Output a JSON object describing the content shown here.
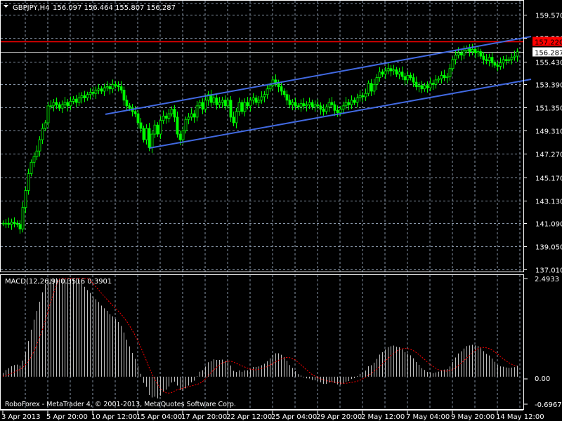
{
  "header": {
    "symbol_label": "GBPJPY,H4",
    "ohlc_label": "156.097 156.464 155.807 156.287"
  },
  "macd_panel": {
    "label": "MACD(12,26,9) 0.3516 0.3901",
    "axis_top": "2.4933",
    "axis_zero": "0.00",
    "axis_bottom": "-0.6967"
  },
  "footer": {
    "copyright": "RoboForex - MetaTrader 4, © 2001-2013, MetaQuotes Software Corp."
  },
  "colors": {
    "background": "#000000",
    "candle": "#00ff00",
    "trendline": "#4169e1",
    "resistance": "#ff0000",
    "bid_line": "#c0c0c0",
    "grid": "#8896a8",
    "macd_hist": "#c0c0c0",
    "macd_signal": "#ff0000"
  },
  "chart_data": {
    "type": "candlestick",
    "symbol": "GBPJPY",
    "timeframe": "H4",
    "ylim": [
      137.01,
      159.57
    ],
    "y_ticks": [
      "159.570",
      "157.530",
      "155.430",
      "153.390",
      "151.350",
      "149.310",
      "147.270",
      "145.170",
      "143.130",
      "141.090",
      "139.050",
      "137.010"
    ],
    "x_ticks": [
      "3 Apr 2013",
      "5 Apr 20:00",
      "10 Apr 12:00",
      "15 Apr 04:00",
      "17 Apr 20:00",
      "22 Apr 12:00",
      "25 Apr 04:00",
      "29 Apr 20:00",
      "2 May 12:00",
      "7 May 04:00",
      "9 May 20:00",
      "14 May 12:00"
    ],
    "grid": true,
    "closes": [
      141.1,
      141.1,
      141.0,
      141.2,
      141.1,
      141.0,
      140.6,
      142.5,
      144.0,
      145.5,
      146.5,
      147.0,
      147.5,
      148.5,
      149.5,
      150.0,
      151.5,
      151.5,
      151.8,
      151.6,
      151.3,
      151.6,
      151.8,
      151.5,
      151.9,
      152.1,
      151.8,
      152.2,
      152.4,
      152.2,
      152.5,
      152.7,
      152.6,
      152.9,
      153.0,
      152.8,
      153.1,
      153.2,
      153.0,
      153.4,
      153.3,
      153.2,
      152.9,
      152.0,
      151.5,
      151.3,
      151.0,
      150.8,
      150.0,
      149.5,
      148.5,
      149.5,
      147.8,
      149.0,
      149.8,
      149.0,
      150.2,
      150.6,
      150.4,
      150.8,
      151.2,
      150.5,
      149.0,
      148.5,
      149.3,
      150.3,
      150.5,
      150.8,
      150.5,
      151.5,
      151.8,
      151.2,
      152.0,
      152.5,
      151.8,
      152.2,
      151.6,
      151.8,
      152.0,
      151.5,
      152.0,
      150.5,
      150.0,
      151.0,
      151.8,
      151.0,
      151.8,
      151.5,
      152.0,
      152.2,
      151.8,
      152.0,
      152.3,
      152.5,
      153.0,
      153.3,
      153.8,
      153.5,
      153.2,
      152.8,
      152.5,
      152.0,
      151.6,
      151.8,
      151.5,
      151.4,
      151.7,
      151.5,
      151.6,
      151.8,
      151.4,
      151.6,
      151.5,
      151.2,
      151.0,
      151.4,
      151.8,
      151.6,
      151.1,
      150.9,
      151.2,
      151.5,
      151.8,
      151.6,
      152.0,
      151.8,
      152.2,
      152.4,
      152.3,
      152.6,
      153.5,
      152.8,
      153.4,
      154.0,
      154.5,
      154.3,
      154.6,
      154.8,
      154.6,
      154.7,
      154.3,
      154.5,
      154.1,
      153.8,
      154.2,
      154.0,
      153.6,
      153.2,
      153.3,
      153.0,
      153.3,
      153.1,
      153.5,
      153.4,
      153.8,
      153.9,
      154.2,
      154.0,
      154.1,
      154.8,
      155.6,
      156.0,
      156.2,
      156.0,
      156.4,
      156.6,
      156.3,
      156.5,
      156.2,
      156.3,
      155.9,
      155.6,
      155.5,
      155.8,
      155.3,
      155.1,
      155.0,
      155.3,
      155.6,
      155.5,
      155.6,
      155.8,
      155.9,
      156.287
    ],
    "horizontal_lines": [
      {
        "price": 157.22,
        "label": "157.220",
        "color": "#ff0000"
      },
      {
        "price": 156.287,
        "label": "156.287",
        "color": "#c0c0c0"
      }
    ],
    "trendlines": [
      {
        "name": "upper-channel",
        "start": {
          "bar": 36.5,
          "price": 150.75
        },
        "end": {
          "bar": 188,
          "price": 157.64
        }
      },
      {
        "name": "lower-channel",
        "start": {
          "bar": 52.2,
          "price": 147.76
        },
        "end": {
          "bar": 188,
          "price": 153.85
        }
      }
    ],
    "macd": {
      "fast": 12,
      "slow": 26,
      "signal": 9,
      "ylim": [
        -0.6967,
        2.4933
      ],
      "main": 0.3516,
      "signal_value": 0.3901
    }
  }
}
